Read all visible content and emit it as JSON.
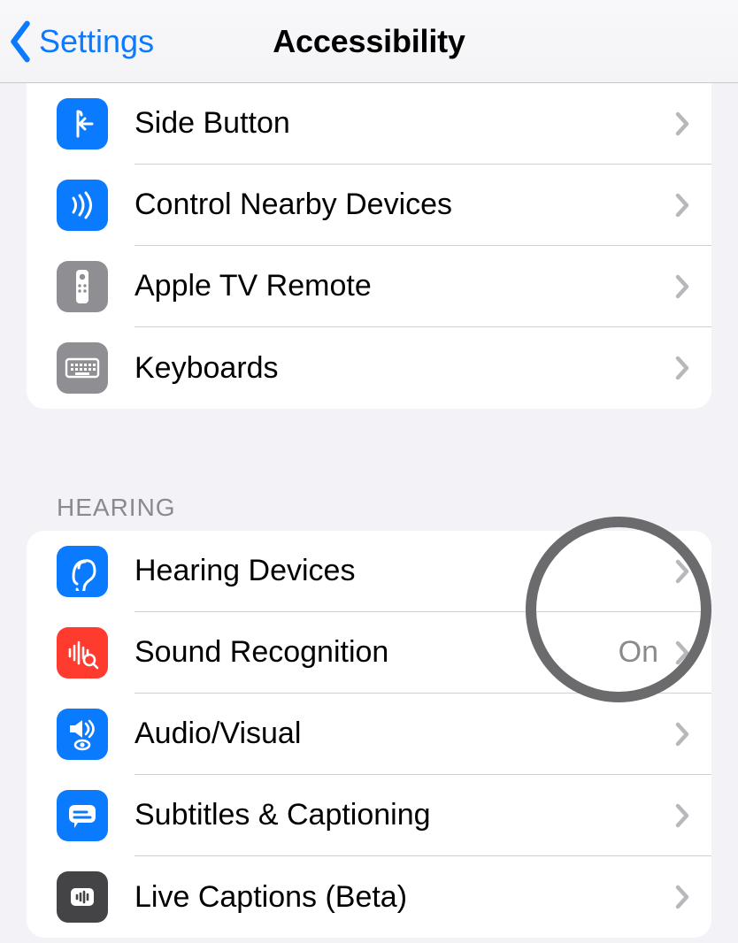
{
  "nav": {
    "back_label": "Settings",
    "title": "Accessibility"
  },
  "group_physical": {
    "rows": [
      {
        "label": "Side Button"
      },
      {
        "label": "Control Nearby Devices"
      },
      {
        "label": "Apple TV Remote"
      },
      {
        "label": "Keyboards"
      }
    ]
  },
  "section_hearing_header": "HEARING",
  "group_hearing": {
    "rows": [
      {
        "label": "Hearing Devices",
        "value": ""
      },
      {
        "label": "Sound Recognition",
        "value": "On"
      },
      {
        "label": "Audio/Visual",
        "value": ""
      },
      {
        "label": "Subtitles & Captioning",
        "value": ""
      },
      {
        "label": "Live Captions (Beta)",
        "value": ""
      }
    ]
  }
}
